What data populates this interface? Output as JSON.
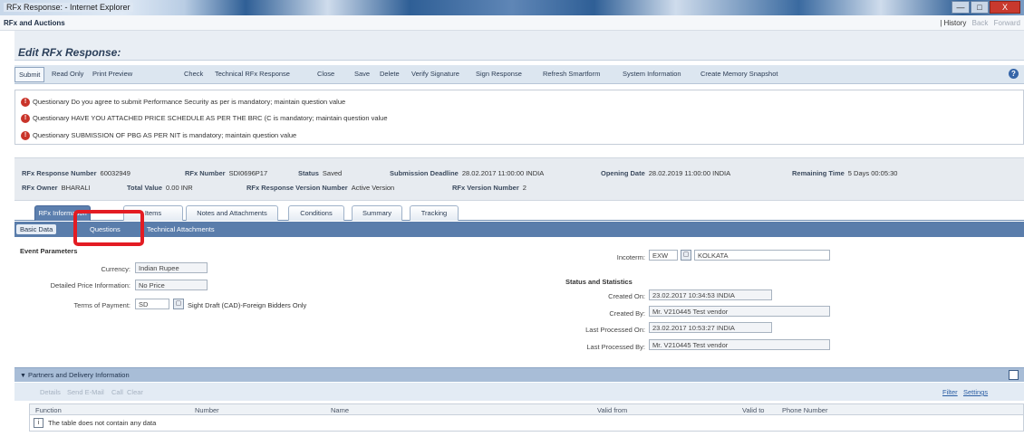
{
  "window": {
    "title": "RFx Response: - Internet Explorer",
    "buttons": [
      "—",
      "□",
      "X"
    ]
  },
  "app": {
    "title": "RFx and Auctions",
    "history": "| History",
    "back": "Back",
    "forward": "Forward"
  },
  "page": {
    "title": "Edit RFx Response:"
  },
  "toolbar": {
    "submit": "Submit",
    "read_only": "Read Only",
    "print_preview": "Print Preview",
    "check": "Check",
    "technical_rfx_response": "Technical RFx Response",
    "close": "Close",
    "save": "Save",
    "delete": "Delete",
    "verify_signature": "Verify Signature",
    "sign_response": "Sign Response",
    "refresh_smartform": "Refresh Smartform",
    "system_information": "System Information",
    "create_memory_snapshot": "Create Memory Snapshot",
    "help": "?"
  },
  "messages": [
    "Questionary Do you agree to submit Performance Security as per is mandatory; maintain question value",
    "Questionary HAVE YOU ATTACHED PRICE SCHEDULE AS PER THE BRC (C is mandatory; maintain question value",
    "Questionary SUBMISSION OF PBG AS PER NIT is mandatory; maintain question value"
  ],
  "summary": {
    "rfx_response_number_label": "RFx Response Number",
    "rfx_response_number": "60032949",
    "rfx_number_label": "RFx Number",
    "rfx_number": "SDI0696P17",
    "status_label": "Status",
    "status": "Saved",
    "submission_deadline_label": "Submission Deadline",
    "submission_deadline": "28.02.2017 11:00:00 INDIA",
    "opening_date_label": "Opening Date",
    "opening_date": "28.02.2019 11:00:00 INDIA",
    "remaining_time_label": "Remaining Time",
    "remaining_time": "5 Days 00:05:30",
    "rfx_owner_label": "RFx Owner",
    "rfx_owner": "BHARALI",
    "total_value_label": "Total Value",
    "total_value": "0.00 INR",
    "response_version_label": "RFx Response Version Number",
    "response_version": "Active Version",
    "rfx_version_label": "RFx Version Number",
    "rfx_version": "2"
  },
  "tabs": [
    "RFx Information",
    "Items",
    "Notes and Attachments",
    "Conditions",
    "Summary",
    "Tracking"
  ],
  "subtabs": [
    "Basic Data",
    "Questions",
    "Technical Attachments"
  ],
  "event_parameters": {
    "title": "Event Parameters",
    "currency_label": "Currency:",
    "currency": "Indian Rupee",
    "price_info_label": "Detailed Price Information:",
    "price_info": "No Price",
    "terms_label": "Terms of Payment:",
    "terms_code": "SD",
    "terms_text": "Sight Draft (CAD)-Foreign Bidders Only"
  },
  "incoterm": {
    "label": "Incoterm:",
    "code": "EXW",
    "location": "KOLKATA"
  },
  "status_statistics": {
    "title": "Status and Statistics",
    "created_on_label": "Created On:",
    "created_on": "23.02.2017 10:34:53 INDIA",
    "created_by_label": "Created By:",
    "created_by": "Mr. V210445 Test vendor",
    "last_processed_on_label": "Last Processed On:",
    "last_processed_on": "23.02.2017 10:53:27 INDIA",
    "last_processed_by_label": "Last Processed By:",
    "last_processed_by": "Mr. V210445 Test vendor"
  },
  "partners": {
    "title": "Partners and Delivery Information",
    "actions": [
      "Details",
      "Send E-Mail",
      "Call",
      "Clear"
    ],
    "filter": "Filter",
    "settings": "Settings",
    "columns": [
      "Function",
      "Number",
      "Name",
      "Valid from",
      "Valid to",
      "Phone Number"
    ],
    "empty": "The table does not contain any data"
  },
  "colors": {
    "accent": "#5a7dab",
    "error": "#c9342a",
    "highlight": "#e31c23"
  }
}
